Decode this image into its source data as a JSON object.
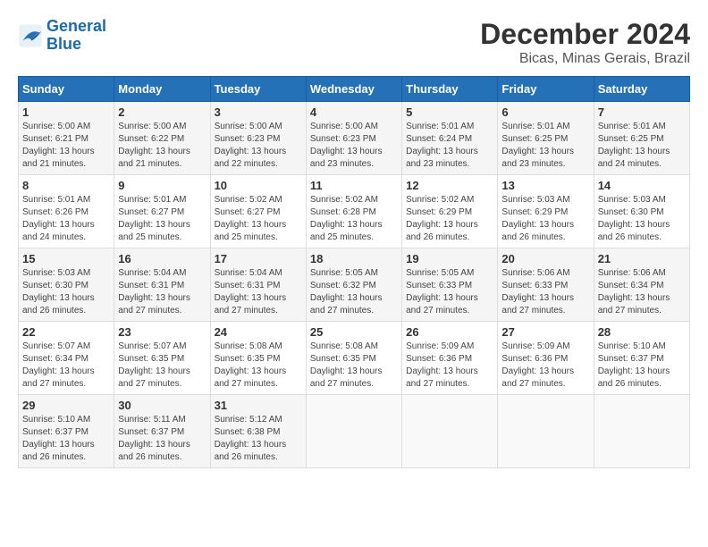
{
  "logo": {
    "line1": "General",
    "line2": "Blue"
  },
  "title": "December 2024",
  "subtitle": "Bicas, Minas Gerais, Brazil",
  "days_of_week": [
    "Sunday",
    "Monday",
    "Tuesday",
    "Wednesday",
    "Thursday",
    "Friday",
    "Saturday"
  ],
  "weeks": [
    [
      {
        "day": "1",
        "rise": "5:00 AM",
        "set": "6:21 PM",
        "daylight": "13 hours and 21 minutes."
      },
      {
        "day": "2",
        "rise": "5:00 AM",
        "set": "6:22 PM",
        "daylight": "13 hours and 21 minutes."
      },
      {
        "day": "3",
        "rise": "5:00 AM",
        "set": "6:23 PM",
        "daylight": "13 hours and 22 minutes."
      },
      {
        "day": "4",
        "rise": "5:00 AM",
        "set": "6:23 PM",
        "daylight": "13 hours and 23 minutes."
      },
      {
        "day": "5",
        "rise": "5:01 AM",
        "set": "6:24 PM",
        "daylight": "13 hours and 23 minutes."
      },
      {
        "day": "6",
        "rise": "5:01 AM",
        "set": "6:25 PM",
        "daylight": "13 hours and 23 minutes."
      },
      {
        "day": "7",
        "rise": "5:01 AM",
        "set": "6:25 PM",
        "daylight": "13 hours and 24 minutes."
      }
    ],
    [
      {
        "day": "8",
        "rise": "5:01 AM",
        "set": "6:26 PM",
        "daylight": "13 hours and 24 minutes."
      },
      {
        "day": "9",
        "rise": "5:01 AM",
        "set": "6:27 PM",
        "daylight": "13 hours and 25 minutes."
      },
      {
        "day": "10",
        "rise": "5:02 AM",
        "set": "6:27 PM",
        "daylight": "13 hours and 25 minutes."
      },
      {
        "day": "11",
        "rise": "5:02 AM",
        "set": "6:28 PM",
        "daylight": "13 hours and 25 minutes."
      },
      {
        "day": "12",
        "rise": "5:02 AM",
        "set": "6:29 PM",
        "daylight": "13 hours and 26 minutes."
      },
      {
        "day": "13",
        "rise": "5:03 AM",
        "set": "6:29 PM",
        "daylight": "13 hours and 26 minutes."
      },
      {
        "day": "14",
        "rise": "5:03 AM",
        "set": "6:30 PM",
        "daylight": "13 hours and 26 minutes."
      }
    ],
    [
      {
        "day": "15",
        "rise": "5:03 AM",
        "set": "6:30 PM",
        "daylight": "13 hours and 26 minutes."
      },
      {
        "day": "16",
        "rise": "5:04 AM",
        "set": "6:31 PM",
        "daylight": "13 hours and 27 minutes."
      },
      {
        "day": "17",
        "rise": "5:04 AM",
        "set": "6:31 PM",
        "daylight": "13 hours and 27 minutes."
      },
      {
        "day": "18",
        "rise": "5:05 AM",
        "set": "6:32 PM",
        "daylight": "13 hours and 27 minutes."
      },
      {
        "day": "19",
        "rise": "5:05 AM",
        "set": "6:33 PM",
        "daylight": "13 hours and 27 minutes."
      },
      {
        "day": "20",
        "rise": "5:06 AM",
        "set": "6:33 PM",
        "daylight": "13 hours and 27 minutes."
      },
      {
        "day": "21",
        "rise": "5:06 AM",
        "set": "6:34 PM",
        "daylight": "13 hours and 27 minutes."
      }
    ],
    [
      {
        "day": "22",
        "rise": "5:07 AM",
        "set": "6:34 PM",
        "daylight": "13 hours and 27 minutes."
      },
      {
        "day": "23",
        "rise": "5:07 AM",
        "set": "6:35 PM",
        "daylight": "13 hours and 27 minutes."
      },
      {
        "day": "24",
        "rise": "5:08 AM",
        "set": "6:35 PM",
        "daylight": "13 hours and 27 minutes."
      },
      {
        "day": "25",
        "rise": "5:08 AM",
        "set": "6:35 PM",
        "daylight": "13 hours and 27 minutes."
      },
      {
        "day": "26",
        "rise": "5:09 AM",
        "set": "6:36 PM",
        "daylight": "13 hours and 27 minutes."
      },
      {
        "day": "27",
        "rise": "5:09 AM",
        "set": "6:36 PM",
        "daylight": "13 hours and 27 minutes."
      },
      {
        "day": "28",
        "rise": "5:10 AM",
        "set": "6:37 PM",
        "daylight": "13 hours and 26 minutes."
      }
    ],
    [
      {
        "day": "29",
        "rise": "5:10 AM",
        "set": "6:37 PM",
        "daylight": "13 hours and 26 minutes."
      },
      {
        "day": "30",
        "rise": "5:11 AM",
        "set": "6:37 PM",
        "daylight": "13 hours and 26 minutes."
      },
      {
        "day": "31",
        "rise": "5:12 AM",
        "set": "6:38 PM",
        "daylight": "13 hours and 26 minutes."
      },
      null,
      null,
      null,
      null
    ]
  ],
  "labels": {
    "sunrise": "Sunrise:",
    "sunset": "Sunset:",
    "daylight": "Daylight:"
  }
}
